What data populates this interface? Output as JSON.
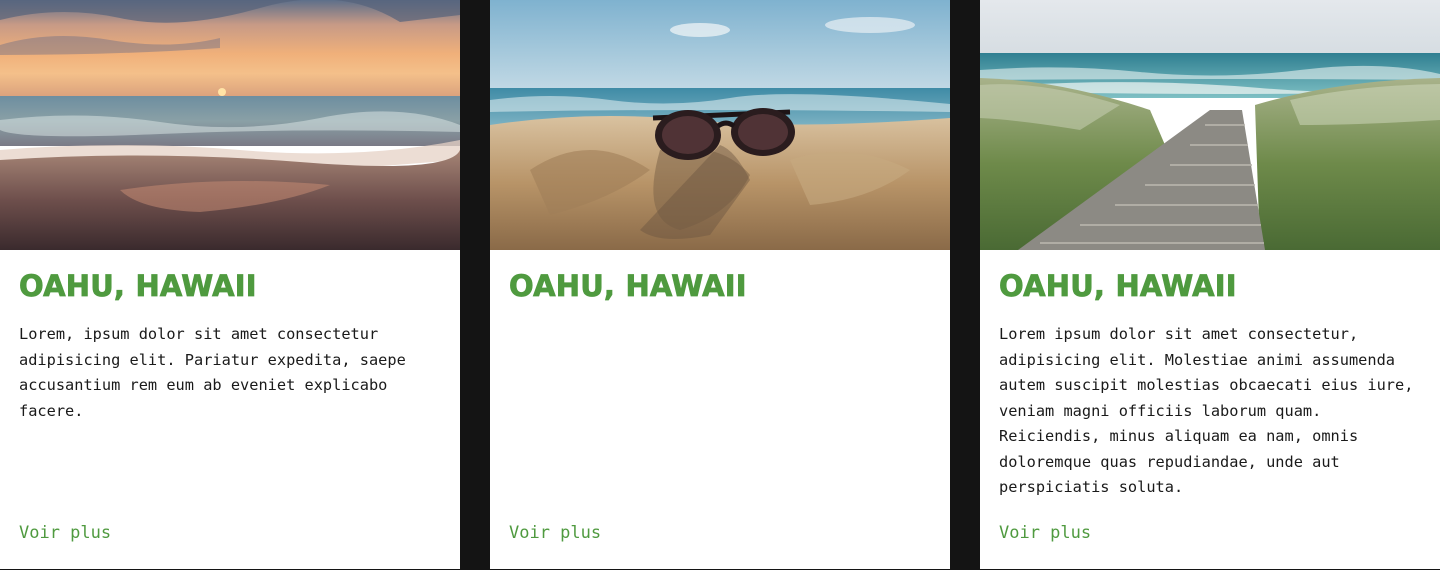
{
  "cards": [
    {
      "image": "sunset-beach-photo",
      "title": "OAHU, HAWAII",
      "text": "Lorem, ipsum dolor sit amet consectetur adipisicing elit. Pariatur expedita, saepe accusantium rem eum ab eveniet explicabo facere.",
      "link": "Voir plus"
    },
    {
      "image": "sunglasses-on-sand-photo",
      "title": "OAHU, HAWAII",
      "text": "",
      "link": "Voir plus"
    },
    {
      "image": "boardwalk-to-sea-photo",
      "title": "OAHU, HAWAII",
      "text": "Lorem ipsum dolor sit amet consectetur, adipisicing elit. Molestiae animi assumenda autem suscipit molestias obcaecati eius iure, veniam magni officiis laborum quam. Reiciendis, minus aliquam ea nam, omnis doloremque quas repudiandae, unde aut perspiciatis soluta.",
      "link": "Voir plus"
    }
  ],
  "colors": {
    "accent": "#4f9a3f",
    "background": "#141414",
    "card": "#ffffff"
  }
}
